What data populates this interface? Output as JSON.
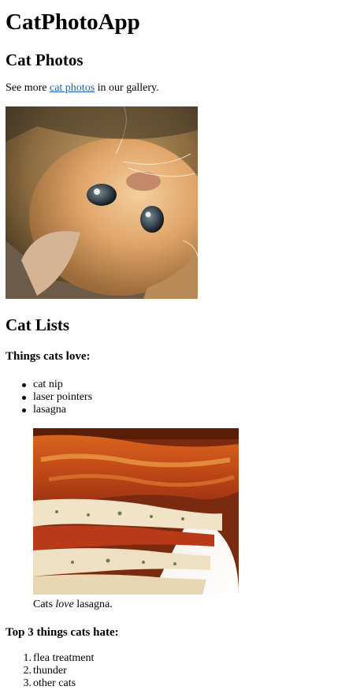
{
  "app_title": "CatPhotoApp",
  "photos_section": {
    "heading": "Cat Photos",
    "intro_before": "See more ",
    "intro_link": "cat photos",
    "intro_after": " in our gallery."
  },
  "lists_section": {
    "heading": "Cat Lists",
    "love_heading": "Things cats love:",
    "love_items": [
      "cat nip",
      "laser pointers",
      "lasagna"
    ],
    "caption_before": "Cats ",
    "caption_em": "love",
    "caption_after": " lasagna.",
    "hate_heading": "Top 3 things cats hate:",
    "hate_items": [
      "flea treatment",
      "thunder",
      "other cats"
    ]
  },
  "colors": {
    "link": "#1a5fb4",
    "text": "#000000",
    "background": "#ffffff"
  },
  "icons": {
    "cat_photo": "kitten-photo",
    "lasagna_photo": "lasagna-photo"
  }
}
